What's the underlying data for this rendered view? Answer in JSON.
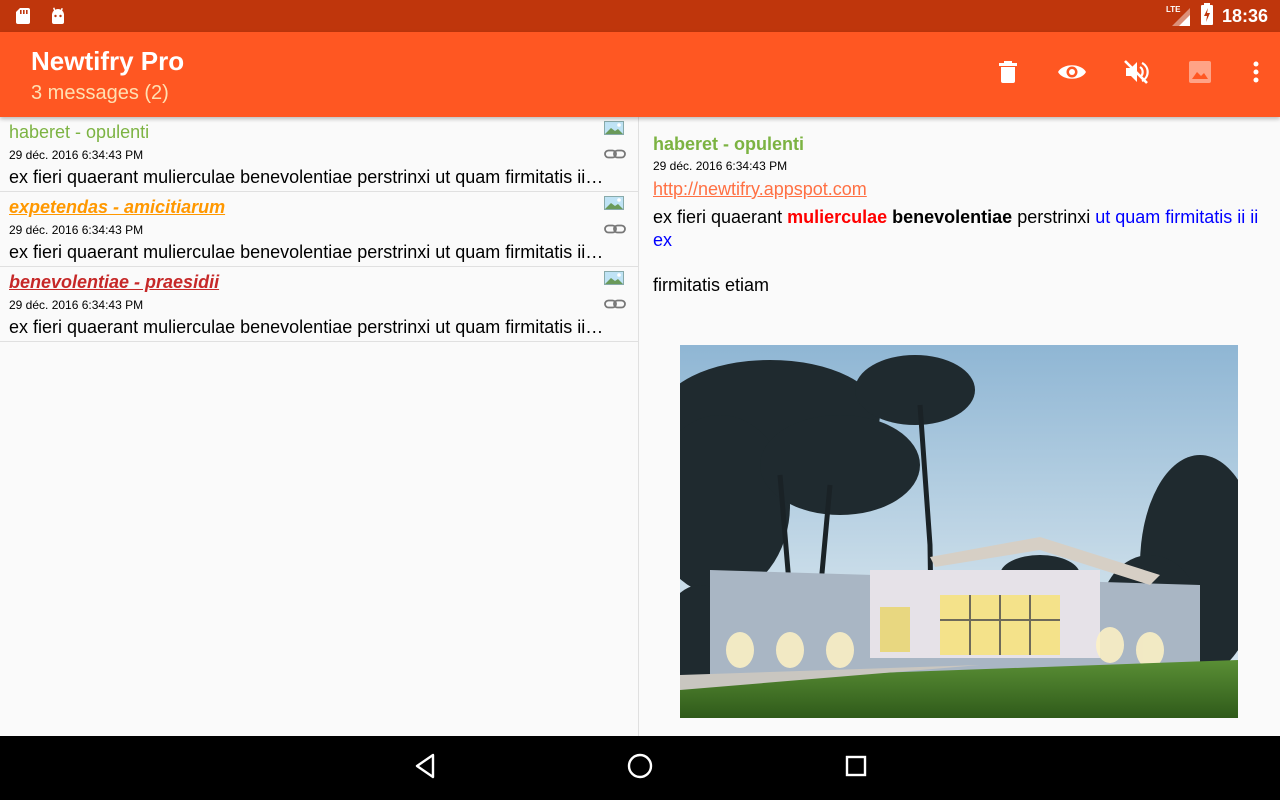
{
  "status_bar": {
    "time": "18:36",
    "network": "LTE"
  },
  "app_bar": {
    "title": "Newtifry Pro",
    "subtitle": "3 messages (2)",
    "actions": [
      "delete-icon",
      "eye-icon",
      "volume-off-icon",
      "image-icon",
      "more-vert-icon"
    ]
  },
  "messages": [
    {
      "title": "haberet - opulenti",
      "date": "29 déc. 2016 6:34:43 PM",
      "preview": "ex fieri quaerant mulierculae benevolentiae perstrinxi ut quam firmitatis ii ii ex",
      "color": "#7cb342"
    },
    {
      "title": "expetendas - amicitiarum",
      "date": "29 déc. 2016 6:34:43 PM",
      "preview": "ex fieri quaerant mulierculae benevolentiae perstrinxi ut quam firmitatis ii ii ex",
      "color": "#ff9800"
    },
    {
      "title": "benevolentiae - praesidii",
      "date": "29 déc. 2016 6:34:43 PM",
      "preview": "ex fieri quaerant mulierculae benevolentiae perstrinxi ut quam firmitatis ii ii ex",
      "color": "#c62828"
    }
  ],
  "detail": {
    "title": "haberet - opulenti",
    "date": "29 déc. 2016 6:34:43 PM",
    "link": "http://newtifry.appspot.com",
    "body_plain1": "ex fieri quaerant ",
    "body_red": "mulierculae",
    "body_space1": " ",
    "body_bold": "benevolentiae",
    "body_plain2": " perstrinxi ",
    "body_blue": "ut quam firmitatis ii ii ex",
    "body2": "firmitatis etiam"
  },
  "colors": {
    "status_bar": "#bf360c",
    "app_bar": "#ff5722",
    "accent_link": "#ff7043"
  }
}
